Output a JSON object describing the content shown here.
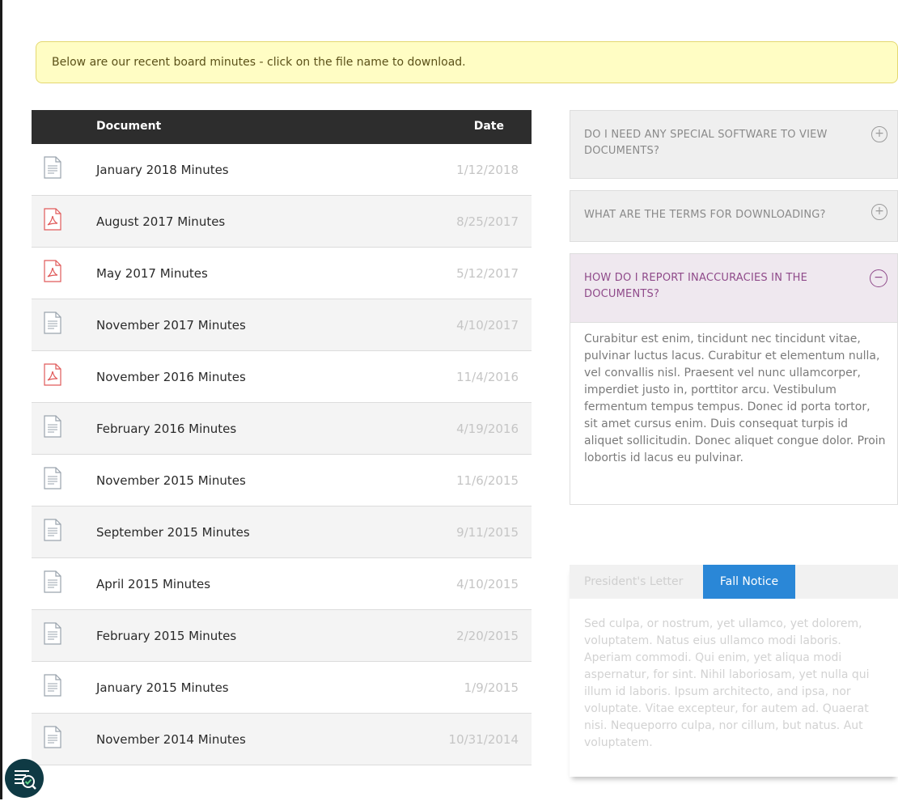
{
  "notice": "Below are our recent board minutes - click on the file name to download.",
  "table": {
    "col_document": "Document",
    "col_date": "Date",
    "rows": [
      {
        "name": "January 2018 Minutes",
        "date": "1/12/2018",
        "type": "doc"
      },
      {
        "name": "August 2017 Minutes",
        "date": "8/25/2017",
        "type": "pdf"
      },
      {
        "name": "May 2017 Minutes",
        "date": "5/12/2017",
        "type": "pdf"
      },
      {
        "name": "November 2017 Minutes",
        "date": "4/10/2017",
        "type": "doc"
      },
      {
        "name": "November 2016 Minutes",
        "date": "11/4/2016",
        "type": "pdf"
      },
      {
        "name": "February 2016 Minutes",
        "date": "4/19/2016",
        "type": "doc"
      },
      {
        "name": "November 2015 Minutes",
        "date": "11/6/2015",
        "type": "doc"
      },
      {
        "name": "September 2015 Minutes",
        "date": "9/11/2015",
        "type": "doc"
      },
      {
        "name": "April 2015 Minutes",
        "date": "4/10/2015",
        "type": "doc"
      },
      {
        "name": "February 2015 Minutes",
        "date": "2/20/2015",
        "type": "doc"
      },
      {
        "name": "January 2015 Minutes",
        "date": "1/9/2015",
        "type": "doc"
      },
      {
        "name": "November 2014 Minutes",
        "date": "10/31/2014",
        "type": "doc"
      }
    ]
  },
  "faq": [
    {
      "question": "DO I NEED ANY SPECIAL SOFTWARE TO VIEW DOCUMENTS?",
      "toggle": "+"
    },
    {
      "question": "WHAT ARE THE TERMS FOR DOWNLOADING?",
      "toggle": "+"
    },
    {
      "question": "HOW DO I REPORT INACCURACIES IN THE DOCUMENTS?",
      "toggle": "−",
      "answer": "Curabitur est enim, tincidunt nec tincidunt vitae, pulvinar luctus lacus. Curabitur et elementum nulla, vel convallis nisl. Praesent vel nunc ullamcorper, imperdiet justo in, porttitor arcu. Vestibulum fermentum tempus tempus. Donec id porta tortor, sit amet cursus enim. Duis consequat turpis id aliquet sollicitudin. Donec aliquet congue dolor. Proin lobortis id lacus eu pulvinar."
    }
  ],
  "tabs": {
    "items": [
      "President's Letter",
      "Fall Notice"
    ],
    "active": "Fall Notice",
    "content": "Sed culpa, or nostrum, yet ullamco, yet dolorem, voluptatem. Natus eius ullamco modi laboris. Aperiam commodi. Qui enim, yet aliqua modi aspernatur, for sint. Nihil laboriosam, yet nulla qui illum id laboris. Ipsum architecto, and ipsa, nor voluptate. Vitae excepteur, for autem ad. Quaerat nisi. Nequeporro culpa, nor cillum, but natus. Aut voluptatem."
  },
  "colors": {
    "accent_blue": "#2a87d7",
    "accordion_open": "#8f4a8a",
    "pdf_red": "#e05a5a",
    "header_dark": "#2d2d2d"
  },
  "icons": {
    "doc": "document-icon",
    "pdf": "pdf-icon",
    "accessibility": "accessibility-icon"
  }
}
